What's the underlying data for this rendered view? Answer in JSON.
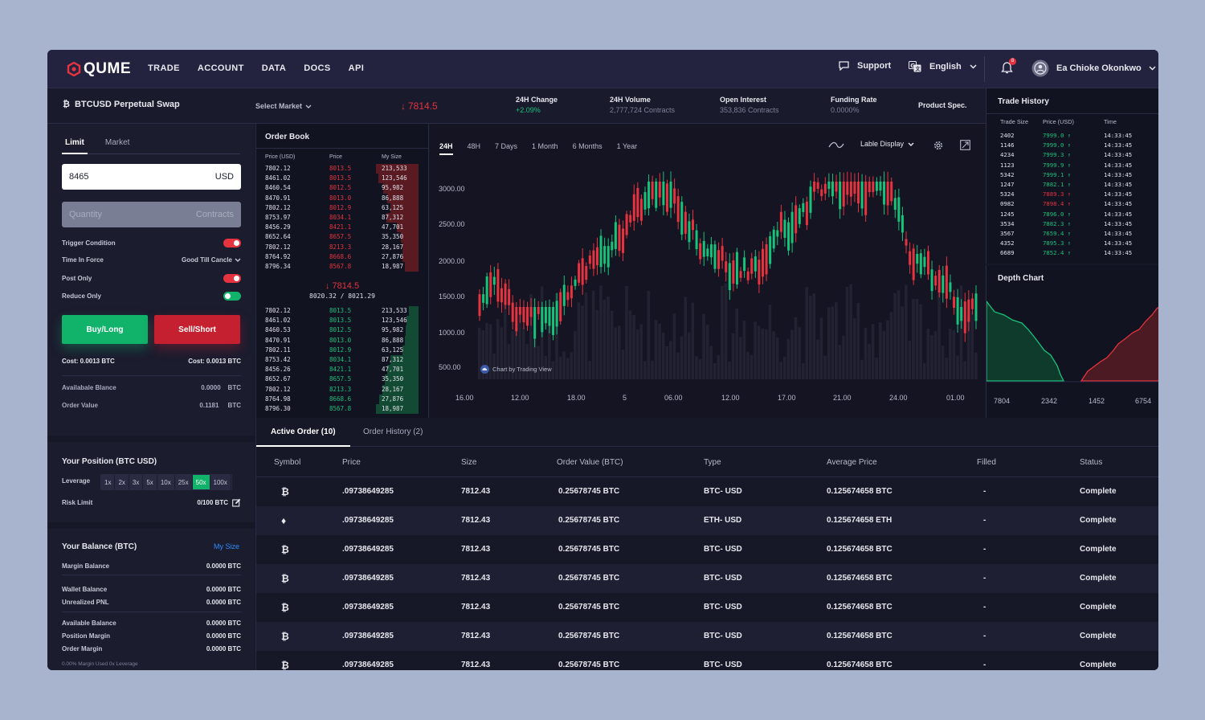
{
  "nav": {
    "brand": "QUME",
    "links": [
      "TRADE",
      "ACCOUNT",
      "DATA",
      "DOCS",
      "API"
    ],
    "support": "Support",
    "language": "English",
    "notifications": "8",
    "user": "Ea Chioke Okonkwo"
  },
  "ticker": {
    "pair": "BTCUSD Perpetual Swap",
    "select_market": "Select Market",
    "last_price": "7814.5",
    "stats": [
      {
        "label": "24H Change",
        "value": "+2.09%"
      },
      {
        "label": "24H Volume",
        "value": "2,777,724 Contracts"
      },
      {
        "label": "Open Interest",
        "value": "353,836 Contracts"
      },
      {
        "label": "Funding Rate",
        "value": "0.0000%"
      }
    ],
    "product_spec": "Product Spec."
  },
  "order_form": {
    "tabs": [
      "Limit",
      "Market"
    ],
    "price_value": "8465",
    "price_unit": "USD",
    "quantity_placeholder": "Quantity",
    "quantity_unit": "Contracts",
    "trigger_condition": "Trigger Condition",
    "time_in_force": "Time In Force",
    "time_in_force_value": "Good Till Cancle",
    "post_only": "Post Only",
    "reduce_only": "Reduce Only",
    "buy": "Buy/Long",
    "sell": "Sell/Short",
    "buy_cost": "Cost: 0.0013 BTC",
    "sell_cost": "Cost: 0.0013 BTC",
    "available_balance_label": "Availabale Blance",
    "available_balance_value": "0.0000",
    "available_balance_unit": "BTC",
    "order_value_label": "Order Value",
    "order_value_value": "0.1181",
    "order_value_unit": "BTC"
  },
  "position": {
    "title": "Your Position (BTC USD)",
    "leverage_label": "Leverage",
    "leverage": [
      "1x",
      "2x",
      "3x",
      "5x",
      "10x",
      "25x",
      "50x",
      "100x"
    ],
    "leverage_selected": 6,
    "risk_label": "Risk Limit",
    "risk_value": "0/100 BTC"
  },
  "balance": {
    "title": "Your Balance (BTC)",
    "link": "My Size",
    "rows": [
      {
        "label": "Margin Balance",
        "value": "0.0000 BTC"
      },
      {
        "label": "Wallet Balance",
        "value": "0.0000 BTC"
      },
      {
        "label": "Unrealized PNL",
        "value": "0.0000 BTC"
      },
      {
        "label": "Available Balance",
        "value": "0.0000 BTC"
      },
      {
        "label": "Position Margin",
        "value": "0.0000 BTC"
      },
      {
        "label": "Order Margin",
        "value": "0.0000 BTC"
      }
    ],
    "note": "0.00% Margin Used 0x Leverage"
  },
  "order_book": {
    "title": "Order Book",
    "headers": [
      "Price (USD)",
      "Price",
      "My Size"
    ],
    "asks": [
      {
        "p": "7802.12",
        "q": "8013.5",
        "s": "213,533",
        "d": 0.95
      },
      {
        "p": "8461.02",
        "q": "8013.5",
        "s": "123,546",
        "d": 0.9
      },
      {
        "p": "8460.54",
        "q": "8012.5",
        "s": "95,982",
        "d": 0.78
      },
      {
        "p": "8470.91",
        "q": "8013.0",
        "s": "86,888",
        "d": 0.7
      },
      {
        "p": "7802.12",
        "q": "8012.9",
        "s": "63,125",
        "d": 0.62
      },
      {
        "p": "8753.97",
        "q": "8034.1",
        "s": "87,312",
        "d": 0.72
      },
      {
        "p": "8456.29",
        "q": "8421.1",
        "s": "47,701",
        "d": 0.48
      },
      {
        "p": "8652.64",
        "q": "8657.5",
        "s": "35,350",
        "d": 0.4
      },
      {
        "p": "7802.12",
        "q": "8213.3",
        "s": "28,167",
        "d": 0.36
      },
      {
        "p": "8764.92",
        "q": "8668.6",
        "s": "27,876",
        "d": 0.35
      },
      {
        "p": "8796.34",
        "q": "8567.8",
        "s": "18,987",
        "d": 0.3
      }
    ],
    "mid_price": "7814.5",
    "mid_range": "8020.32 / 8021.29",
    "bids": [
      {
        "p": "7802.12",
        "q": "8013.5",
        "s": "213,533",
        "d": 0.22
      },
      {
        "p": "8461.02",
        "q": "8013.5",
        "s": "123,546",
        "d": 0.26
      },
      {
        "p": "8460.53",
        "q": "8012.5",
        "s": "95,982",
        "d": 0.28
      },
      {
        "p": "8470.91",
        "q": "8013.0",
        "s": "86,888",
        "d": 0.3
      },
      {
        "p": "7802.11",
        "q": "8012.9",
        "s": "63,125",
        "d": 0.35
      },
      {
        "p": "8753.42",
        "q": "8034.1",
        "s": "87,312",
        "d": 0.62
      },
      {
        "p": "8456.26",
        "q": "8421.1",
        "s": "47,701",
        "d": 0.7
      },
      {
        "p": "8652.67",
        "q": "8657.5",
        "s": "35,350",
        "d": 0.75
      },
      {
        "p": "7802.12",
        "q": "8213.3",
        "s": "28,167",
        "d": 0.8
      },
      {
        "p": "8764.98",
        "q": "8668.6",
        "s": "27,876",
        "d": 0.88
      },
      {
        "p": "8796.30",
        "q": "8567.8",
        "s": "18,987",
        "d": 0.95
      }
    ]
  },
  "chart": {
    "tabs": [
      "24H",
      "48H",
      "7 Days",
      "1 Month",
      "6 Months",
      "1 Year"
    ],
    "label_display": "Lable Display",
    "y_ticks": [
      "3000.00",
      "2500.00",
      "2000.00",
      "1500.00",
      "1000.00",
      "500.00"
    ],
    "x_ticks": [
      "16.00",
      "12.00",
      "18.00",
      "5",
      "06.00",
      "12.00",
      "17.00",
      "21.00",
      "24.00",
      "01.00"
    ],
    "attribution": "Chart by Trading View",
    "up_color": "#17c27a",
    "down_color": "#e5333f"
  },
  "trade_history": {
    "title": "Trade History",
    "headers": [
      "Trade Size",
      "Price (USD)",
      "Time"
    ],
    "rows": [
      {
        "size": "2402",
        "price": "7999.0",
        "time": "14:33:45",
        "up": true
      },
      {
        "size": "1146",
        "price": "7999.0",
        "time": "14:33:45",
        "up": true
      },
      {
        "size": "4234",
        "price": "7999.3",
        "time": "14:33:45",
        "up": true
      },
      {
        "size": "1123",
        "price": "7999.9",
        "time": "14:33:45",
        "up": true
      },
      {
        "size": "5342",
        "price": "7999.1",
        "time": "14:33:45",
        "up": true
      },
      {
        "size": "1247",
        "price": "7882.1",
        "time": "14:33:45",
        "up": true
      },
      {
        "size": "5324",
        "price": "7889.3",
        "time": "14:33:45",
        "up": false
      },
      {
        "size": "0982",
        "price": "7898.4",
        "time": "14:33:45",
        "up": false
      },
      {
        "size": "1245",
        "price": "7896.0",
        "time": "14:33:45",
        "up": true
      },
      {
        "size": "3534",
        "price": "7882.3",
        "time": "14:33:45",
        "up": true
      },
      {
        "size": "3567",
        "price": "7659.4",
        "time": "14:33:45",
        "up": true
      },
      {
        "size": "4352",
        "price": "7895.3",
        "time": "14:33:45",
        "up": true
      },
      {
        "size": "6689",
        "price": "7852.4",
        "time": "14:33:45",
        "up": true
      }
    ]
  },
  "depth": {
    "title": "Depth Chart",
    "x_ticks": [
      "7804",
      "2342",
      "1452",
      "6754"
    ]
  },
  "orders": {
    "tabs": [
      "Active Order (10)",
      "Order History (2)"
    ],
    "headers": [
      "Symbol",
      "Price",
      "Size",
      "Order Value (BTC)",
      "Type",
      "Average Price",
      "Filled",
      "Status"
    ],
    "rows": [
      {
        "sym": "btc",
        "price": ".09738649285",
        "size": "7812.43",
        "value": "0.25678745 BTC",
        "type": "BTC- USD",
        "avg": "0.125674658 BTC",
        "filled": "-",
        "status": "Complete"
      },
      {
        "sym": "eth",
        "price": ".09738649285",
        "size": "7812.43",
        "value": "0.25678745 BTC",
        "type": "ETH- USD",
        "avg": "0.125674658 ETH",
        "filled": "-",
        "status": "Complete"
      },
      {
        "sym": "btc",
        "price": ".09738649285",
        "size": "7812.43",
        "value": "0.25678745 BTC",
        "type": "BTC- USD",
        "avg": "0.125674658 BTC",
        "filled": "-",
        "status": "Complete"
      },
      {
        "sym": "btc",
        "price": ".09738649285",
        "size": "7812.43",
        "value": "0.25678745 BTC",
        "type": "BTC- USD",
        "avg": "0.125674658 BTC",
        "filled": "-",
        "status": "Complete"
      },
      {
        "sym": "btc",
        "price": ".09738649285",
        "size": "7812.43",
        "value": "0.25678745 BTC",
        "type": "BTC- USD",
        "avg": "0.125674658 BTC",
        "filled": "-",
        "status": "Complete"
      },
      {
        "sym": "btc",
        "price": ".09738649285",
        "size": "7812.43",
        "value": "0.25678745 BTC",
        "type": "BTC- USD",
        "avg": "0.125674658 BTC",
        "filled": "-",
        "status": "Complete"
      },
      {
        "sym": "btc",
        "price": ".09738649285",
        "size": "7812.43",
        "value": "0.25678745 BTC",
        "type": "BTC- USD",
        "avg": "0.125674658 BTC",
        "filled": "-",
        "status": "Complete"
      }
    ]
  }
}
